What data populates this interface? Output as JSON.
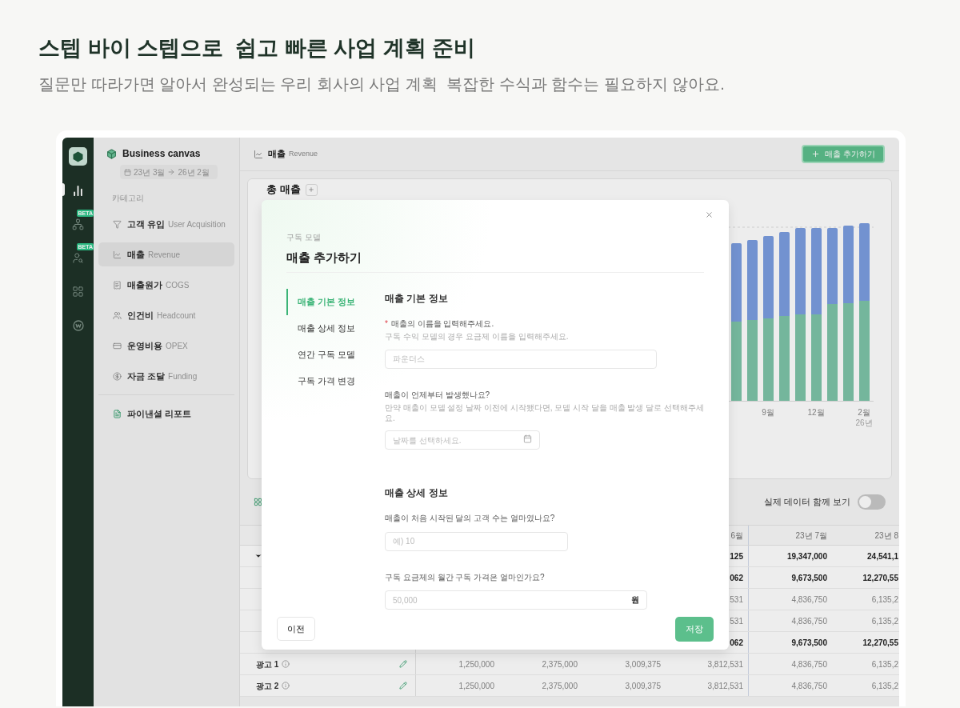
{
  "hero": {
    "title": "스텝 바이 스텝으로  쉽고 빠른 사업 계획 준비",
    "subtitle": "질문만 따라가면 알아서 완성되는 우리 회사의 사업 계획  복잡한 수식과 함수는 필요하지 않아요."
  },
  "rail": {
    "items": [
      {
        "kind": "chart",
        "selected": true
      },
      {
        "kind": "org",
        "selected": false,
        "badge": "BETA"
      },
      {
        "kind": "people",
        "selected": false,
        "badge": "BETA"
      },
      {
        "kind": "grid",
        "selected": false
      },
      {
        "kind": "coin",
        "selected": false
      }
    ]
  },
  "sidebar": {
    "project": "Business canvas",
    "date_from": "23년 3월",
    "date_to": "26년 2월",
    "section_label": "카테고리",
    "items": [
      {
        "kind": "funnel",
        "label": "고객 유입",
        "sublabel": "User Acquisition",
        "selected": false
      },
      {
        "kind": "line",
        "label": "매출",
        "sublabel": "Revenue",
        "selected": true
      },
      {
        "kind": "list",
        "label": "매출원가",
        "sublabel": "COGS",
        "selected": false
      },
      {
        "kind": "people",
        "label": "인건비",
        "sublabel": "Headcount",
        "selected": false
      },
      {
        "kind": "card",
        "label": "운영비용",
        "sublabel": "OPEX",
        "selected": false
      },
      {
        "kind": "dollar",
        "label": "자금 조달",
        "sublabel": "Funding",
        "selected": false
      }
    ],
    "report": "파이낸셜 리포트"
  },
  "header": {
    "title": "매출",
    "subtitle": "Revenue",
    "add_button": "매출 추가하기"
  },
  "chart_card": {
    "title": "총 매출",
    "x_labels": [
      {
        "label": "9월"
      },
      {
        "label": "12월"
      },
      {
        "label": "2월",
        "sub": "26년"
      }
    ]
  },
  "toolbar": {
    "toggle_label": "실제 데이터 함께 보기",
    "toggle_on": false
  },
  "table": {
    "columns": [
      "6월",
      "23년 7월",
      "23년 8"
    ],
    "rows": [
      {
        "expanded": true,
        "bold": true,
        "values": [
          "125",
          "19,347,000",
          "24,541,1"
        ]
      },
      {
        "bold": true,
        "values": [
          "062",
          "9,673,500",
          "12,270,55"
        ]
      },
      {
        "bold": false,
        "values": [
          "531",
          "4,836,750",
          "6,135,2"
        ]
      },
      {
        "bold": false,
        "values": [
          "531",
          "4,836,750",
          "6,135,2"
        ]
      },
      {
        "bold": true,
        "values": [
          "062",
          "9,673,500",
          "12,270,55"
        ]
      },
      {
        "bold": false,
        "label": "광고 1",
        "values": [
          "1,250,000",
          "2,375,000",
          "3,009,375",
          "3,812,531",
          "4,836,750",
          "6,135,2"
        ]
      },
      {
        "bold": false,
        "label": "광고 2",
        "values": [
          "1,250,000",
          "2,375,000",
          "3,009,375",
          "3,812,531",
          "4,836,750",
          "6,135,2"
        ]
      }
    ]
  },
  "modal": {
    "eyebrow": "구독 모델",
    "title": "매출 추가하기",
    "nav": [
      {
        "label": "매출 기본 정보",
        "selected": true
      },
      {
        "label": "매출 상세 정보",
        "selected": false
      },
      {
        "label": "연간 구독 모델",
        "selected": false
      },
      {
        "label": "구독 가격 변경",
        "selected": false
      }
    ],
    "sections": [
      {
        "title": "매출 기본 정보",
        "fields": [
          {
            "kind": "text",
            "required_mark": "*",
            "label": "매출의 이름을 입력해주세요.",
            "helper": "구독 수익 모델의 경우 요금제 이름을 입력해주세요.",
            "placeholder": "파운더스"
          },
          {
            "kind": "date",
            "label": "매출이 언제부터 발생했나요?",
            "helper": "만약 매출이 모델 설정 날짜 이전에 시작됐다면, 모델 시작 달을 매출 발생 달로 선택해주세요.",
            "placeholder": "날짜를 선택하세요."
          }
        ]
      },
      {
        "title": "매출 상세 정보",
        "fields": [
          {
            "kind": "number",
            "label": "매출이 처음 시작된 달의 고객 수는 얼마였나요?",
            "placeholder": "예) 10"
          },
          {
            "kind": "currency",
            "label": "구독 요금제의 월간 구독 가격은 얼마인가요?",
            "placeholder": "50,000",
            "suffix": "원"
          }
        ]
      }
    ],
    "prev_button": "이전",
    "save_button": "저장"
  }
}
